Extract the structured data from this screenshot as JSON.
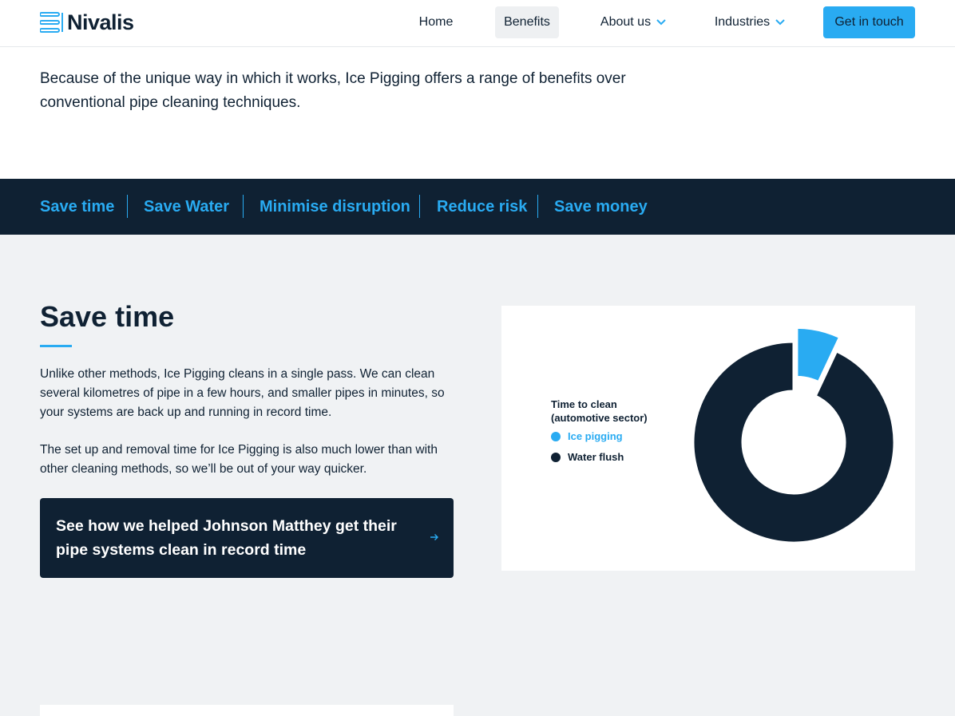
{
  "header": {
    "logo_text": "Nivalis",
    "nav": {
      "home": "Home",
      "benefits": "Benefits",
      "about": "About us",
      "industries": "Industries"
    },
    "cta": "Get in touch"
  },
  "intro": "Because of the unique way in which it works, Ice Pigging offers a range of benefits over conventional pipe cleaning techniques.",
  "tabs": [
    "Save time",
    "Save Water",
    "Minimise disruption",
    "Reduce risk",
    "Save money"
  ],
  "section": {
    "title": "Save time",
    "para1": "Unlike other methods, Ice Pigging cleans in a single pass. We can clean several kilometres of pipe in a few hours, and smaller pipes in minutes, so your systems are back up and running in record time.",
    "para2": "The set up and removal time for Ice Pigging is also much lower than with other cleaning methods, so we’ll be out of your way quicker.",
    "case_card": "See how we helped Johnson Matthey get their pipe systems clean in record time"
  },
  "colors": {
    "navy": "#0f2133",
    "accent": "#29abf2",
    "panel_bg": "#f0f2f4"
  },
  "chart_data": {
    "type": "pie",
    "title": "Time to clean (automotive sector)",
    "series": [
      {
        "name": "Ice pigging",
        "value": 7,
        "color": "#29abf2",
        "exploded": true
      },
      {
        "name": "Water flush",
        "value": 93,
        "color": "#0f2133",
        "exploded": false
      }
    ],
    "legend_position": "left"
  }
}
